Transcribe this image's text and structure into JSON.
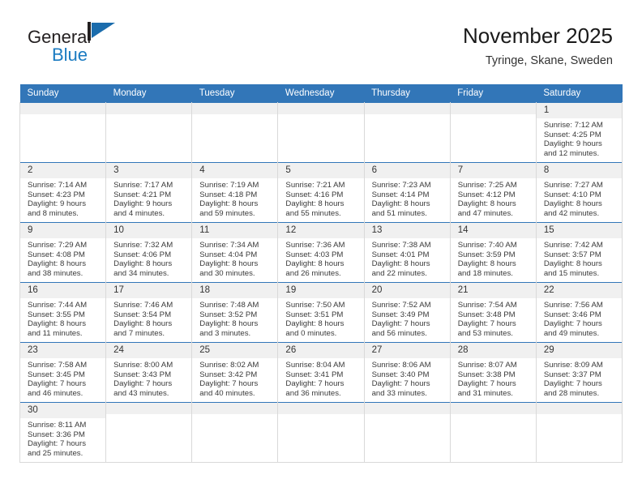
{
  "brand": {
    "name_part1": "General",
    "name_part2": "Blue",
    "flag_icon": "blue-triangle-flag-icon",
    "primary_color": "#1b7bc1",
    "header_color": "#3276b8"
  },
  "header": {
    "title": "November 2025",
    "subtitle": "Tyringe, Skane, Sweden"
  },
  "weekdays": [
    "Sunday",
    "Monday",
    "Tuesday",
    "Wednesday",
    "Thursday",
    "Friday",
    "Saturday"
  ],
  "labels": {
    "sunrise_prefix": "Sunrise:",
    "sunset_prefix": "Sunset:",
    "daylight_prefix": "Daylight:"
  },
  "weeks": [
    [
      {
        "day": "",
        "empty": true
      },
      {
        "day": "",
        "empty": true
      },
      {
        "day": "",
        "empty": true
      },
      {
        "day": "",
        "empty": true
      },
      {
        "day": "",
        "empty": true
      },
      {
        "day": "",
        "empty": true
      },
      {
        "day": "1",
        "sunrise": "Sunrise: 7:12 AM",
        "sunset": "Sunset: 4:25 PM",
        "daylight": "Daylight: 9 hours and 12 minutes."
      }
    ],
    [
      {
        "day": "2",
        "sunrise": "Sunrise: 7:14 AM",
        "sunset": "Sunset: 4:23 PM",
        "daylight": "Daylight: 9 hours and 8 minutes."
      },
      {
        "day": "3",
        "sunrise": "Sunrise: 7:17 AM",
        "sunset": "Sunset: 4:21 PM",
        "daylight": "Daylight: 9 hours and 4 minutes."
      },
      {
        "day": "4",
        "sunrise": "Sunrise: 7:19 AM",
        "sunset": "Sunset: 4:18 PM",
        "daylight": "Daylight: 8 hours and 59 minutes."
      },
      {
        "day": "5",
        "sunrise": "Sunrise: 7:21 AM",
        "sunset": "Sunset: 4:16 PM",
        "daylight": "Daylight: 8 hours and 55 minutes."
      },
      {
        "day": "6",
        "sunrise": "Sunrise: 7:23 AM",
        "sunset": "Sunset: 4:14 PM",
        "daylight": "Daylight: 8 hours and 51 minutes."
      },
      {
        "day": "7",
        "sunrise": "Sunrise: 7:25 AM",
        "sunset": "Sunset: 4:12 PM",
        "daylight": "Daylight: 8 hours and 47 minutes."
      },
      {
        "day": "8",
        "sunrise": "Sunrise: 7:27 AM",
        "sunset": "Sunset: 4:10 PM",
        "daylight": "Daylight: 8 hours and 42 minutes."
      }
    ],
    [
      {
        "day": "9",
        "sunrise": "Sunrise: 7:29 AM",
        "sunset": "Sunset: 4:08 PM",
        "daylight": "Daylight: 8 hours and 38 minutes."
      },
      {
        "day": "10",
        "sunrise": "Sunrise: 7:32 AM",
        "sunset": "Sunset: 4:06 PM",
        "daylight": "Daylight: 8 hours and 34 minutes."
      },
      {
        "day": "11",
        "sunrise": "Sunrise: 7:34 AM",
        "sunset": "Sunset: 4:04 PM",
        "daylight": "Daylight: 8 hours and 30 minutes."
      },
      {
        "day": "12",
        "sunrise": "Sunrise: 7:36 AM",
        "sunset": "Sunset: 4:03 PM",
        "daylight": "Daylight: 8 hours and 26 minutes."
      },
      {
        "day": "13",
        "sunrise": "Sunrise: 7:38 AM",
        "sunset": "Sunset: 4:01 PM",
        "daylight": "Daylight: 8 hours and 22 minutes."
      },
      {
        "day": "14",
        "sunrise": "Sunrise: 7:40 AM",
        "sunset": "Sunset: 3:59 PM",
        "daylight": "Daylight: 8 hours and 18 minutes."
      },
      {
        "day": "15",
        "sunrise": "Sunrise: 7:42 AM",
        "sunset": "Sunset: 3:57 PM",
        "daylight": "Daylight: 8 hours and 15 minutes."
      }
    ],
    [
      {
        "day": "16",
        "sunrise": "Sunrise: 7:44 AM",
        "sunset": "Sunset: 3:55 PM",
        "daylight": "Daylight: 8 hours and 11 minutes."
      },
      {
        "day": "17",
        "sunrise": "Sunrise: 7:46 AM",
        "sunset": "Sunset: 3:54 PM",
        "daylight": "Daylight: 8 hours and 7 minutes."
      },
      {
        "day": "18",
        "sunrise": "Sunrise: 7:48 AM",
        "sunset": "Sunset: 3:52 PM",
        "daylight": "Daylight: 8 hours and 3 minutes."
      },
      {
        "day": "19",
        "sunrise": "Sunrise: 7:50 AM",
        "sunset": "Sunset: 3:51 PM",
        "daylight": "Daylight: 8 hours and 0 minutes."
      },
      {
        "day": "20",
        "sunrise": "Sunrise: 7:52 AM",
        "sunset": "Sunset: 3:49 PM",
        "daylight": "Daylight: 7 hours and 56 minutes."
      },
      {
        "day": "21",
        "sunrise": "Sunrise: 7:54 AM",
        "sunset": "Sunset: 3:48 PM",
        "daylight": "Daylight: 7 hours and 53 minutes."
      },
      {
        "day": "22",
        "sunrise": "Sunrise: 7:56 AM",
        "sunset": "Sunset: 3:46 PM",
        "daylight": "Daylight: 7 hours and 49 minutes."
      }
    ],
    [
      {
        "day": "23",
        "sunrise": "Sunrise: 7:58 AM",
        "sunset": "Sunset: 3:45 PM",
        "daylight": "Daylight: 7 hours and 46 minutes."
      },
      {
        "day": "24",
        "sunrise": "Sunrise: 8:00 AM",
        "sunset": "Sunset: 3:43 PM",
        "daylight": "Daylight: 7 hours and 43 minutes."
      },
      {
        "day": "25",
        "sunrise": "Sunrise: 8:02 AM",
        "sunset": "Sunset: 3:42 PM",
        "daylight": "Daylight: 7 hours and 40 minutes."
      },
      {
        "day": "26",
        "sunrise": "Sunrise: 8:04 AM",
        "sunset": "Sunset: 3:41 PM",
        "daylight": "Daylight: 7 hours and 36 minutes."
      },
      {
        "day": "27",
        "sunrise": "Sunrise: 8:06 AM",
        "sunset": "Sunset: 3:40 PM",
        "daylight": "Daylight: 7 hours and 33 minutes."
      },
      {
        "day": "28",
        "sunrise": "Sunrise: 8:07 AM",
        "sunset": "Sunset: 3:38 PM",
        "daylight": "Daylight: 7 hours and 31 minutes."
      },
      {
        "day": "29",
        "sunrise": "Sunrise: 8:09 AM",
        "sunset": "Sunset: 3:37 PM",
        "daylight": "Daylight: 7 hours and 28 minutes."
      }
    ],
    [
      {
        "day": "30",
        "sunrise": "Sunrise: 8:11 AM",
        "sunset": "Sunset: 3:36 PM",
        "daylight": "Daylight: 7 hours and 25 minutes."
      },
      {
        "day": "",
        "empty": true
      },
      {
        "day": "",
        "empty": true
      },
      {
        "day": "",
        "empty": true
      },
      {
        "day": "",
        "empty": true
      },
      {
        "day": "",
        "empty": true
      },
      {
        "day": "",
        "empty": true
      }
    ]
  ]
}
